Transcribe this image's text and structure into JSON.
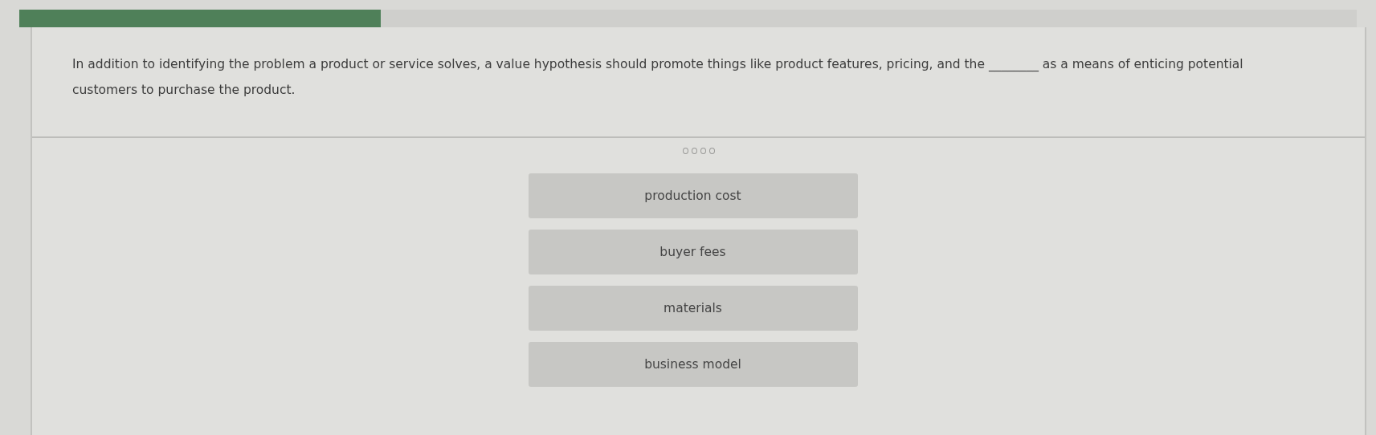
{
  "progress": {
    "level": 0.27
  },
  "question": {
    "text": "In addition to identifying the problem a product or service solves, a value hypothesis should promote things like product features, pricing, and the ________ as a means of enticing potential customers to purchase the product."
  },
  "answers": [
    {
      "label": "production cost",
      "selected": false
    },
    {
      "label": "buyer fees",
      "selected": false
    },
    {
      "label": "materials",
      "selected": false
    },
    {
      "label": "business model",
      "selected": false
    }
  ]
}
